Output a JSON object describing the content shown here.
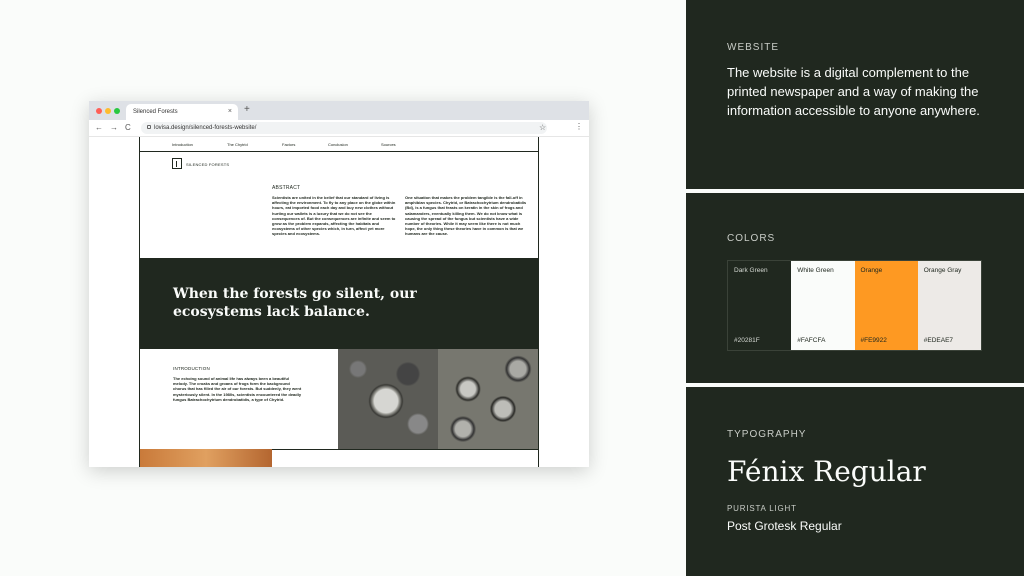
{
  "browser": {
    "tab_title": "Silenced Forests",
    "tab_close": "×",
    "new_tab": "+",
    "back": "←",
    "forward": "→",
    "reload": "C",
    "url": "lovisa.design/silenced-forests-website/",
    "star": "☆",
    "menu": "⋮"
  },
  "site": {
    "nav": [
      "Introduction",
      "The Chytrid",
      "Factors",
      "Conclusion",
      "Sources"
    ],
    "logo_text": "SILENCED FORESTS",
    "abstract_label": "ABSTRACT",
    "abstract_col1": "Scientists are united in the belief that our standard of living is affecting the environment. To fly to any place on the globe within hours, eat imported food each day and buy new clothes without hurting our wallets is a luxury that we do not see the consequences of. But the consequences are infinite and seem to grow as the problem expands, affecting the habitats and ecosystems of other species which, in turn, affect yet more species and ecosystems.",
    "abstract_col2": "One situation that makes the problem tangible is the fall-off in amphibian species. Chytrid, or Batrachochytrium dendrobatidis (Bd), is a fungus that feasts on keratin in the skin of frogs and salamanders, eventually killing them. We do not know what is causing the spread of the fungus but scientists have a wide number of theories. While it may seem like there is not much hope, the only thing these theories have in common is that we humans are the cause.",
    "hero_title": "When the forests go silent, our ecosystems lack balance.",
    "intro_label": "INTRODUCTION",
    "intro_text": "The echoing sound of animal life has always been a beautiful melody. The croaks and groans of frogs form the background chorus that has filled the air of our forests. But suddenly, they went mysteriously silent. In the 1980s, scientists encountered the deadly fungus Batrachochytrium dendrobatidis, a type of Chytrid."
  },
  "website_panel": {
    "label": "WEBSITE",
    "text": "The website is a digital complement to the printed newspaper and a way of making the information accessible to anyone anywhere."
  },
  "colors_panel": {
    "label": "COLORS",
    "swatches": [
      {
        "name": "Dark Green",
        "hex": "#20281F",
        "bg": "#20281F",
        "fg": "#d5d9d3"
      },
      {
        "name": "White Green",
        "hex": "#FAFCFA",
        "bg": "#FAFCFA",
        "fg": "#20281F"
      },
      {
        "name": "Orange",
        "hex": "#FE9922",
        "bg": "#FE9922",
        "fg": "#20281F"
      },
      {
        "name": "Orange Gray",
        "hex": "#EDEAE7",
        "bg": "#EDEAE7",
        "fg": "#20281F"
      }
    ]
  },
  "typography_panel": {
    "label": "TYPOGRAPHY",
    "main_font": "Fénix Regular",
    "secondary_label": "PURISTA LIGHT",
    "secondary_font": "Post Grotesk Regular"
  }
}
